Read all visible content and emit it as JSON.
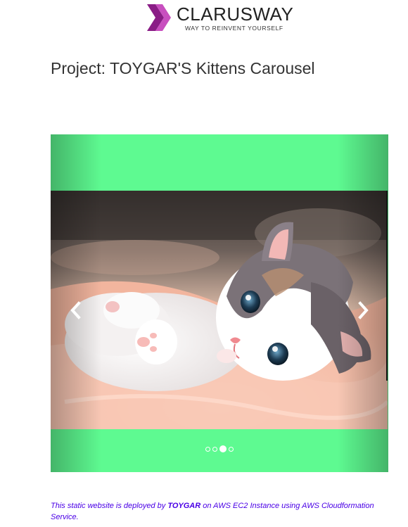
{
  "logo": {
    "name": "CLARUSWAY",
    "tagline": "WAY TO REINVENT YOURSELF",
    "colors": {
      "mark_dark": "#8a1d86",
      "mark_light": "#c84fbf"
    }
  },
  "page": {
    "title": "Project: TOYGAR'S Kittens Carousel"
  },
  "carousel": {
    "background_color": "#5efa91",
    "slide_image": "kitten-photo",
    "controls": {
      "prev_icon": "chevron-left-icon",
      "next_icon": "chevron-right-icon"
    },
    "indicators": [
      {
        "active": false
      },
      {
        "active": false
      },
      {
        "active": true
      },
      {
        "active": false
      }
    ]
  },
  "footer": {
    "text_before": "This static website is deployed by ",
    "author": "TOYGAR",
    "text_after": " on AWS EC2 Instance using AWS Cloudformation Service.",
    "color": "#4a00e6"
  }
}
